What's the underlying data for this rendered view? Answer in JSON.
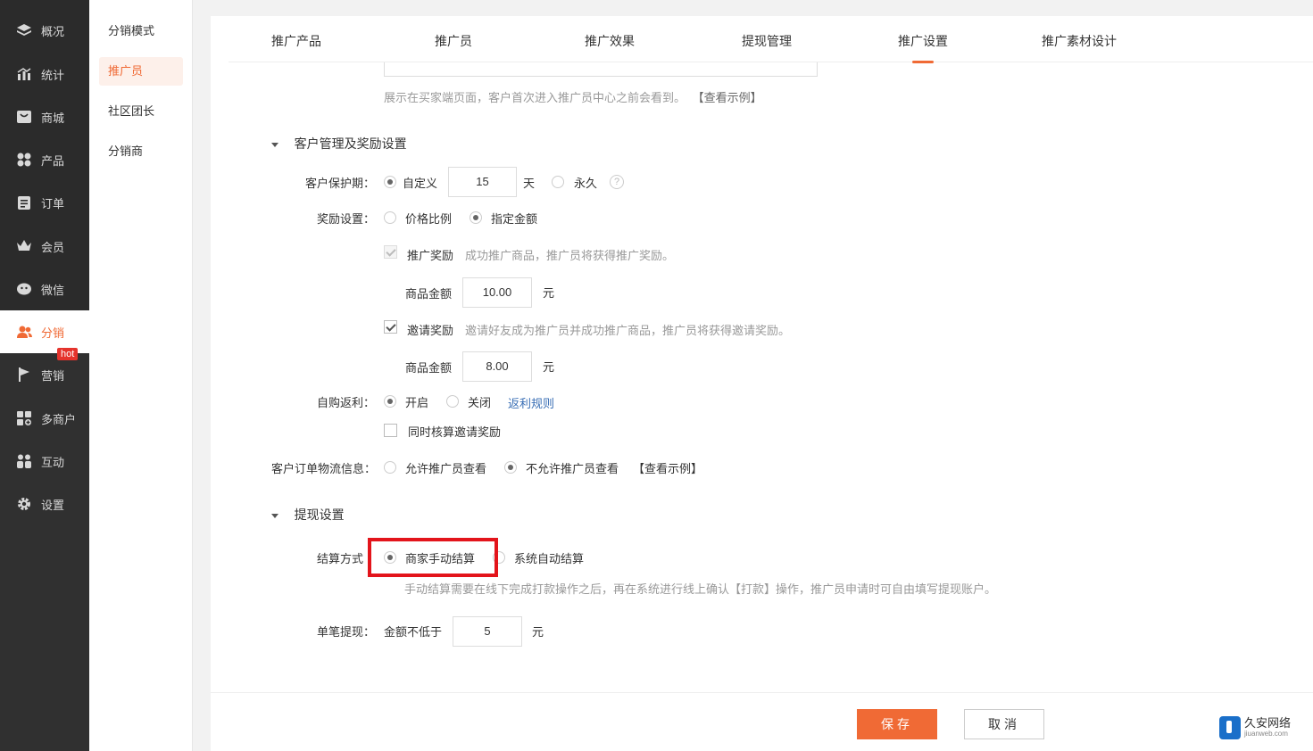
{
  "nav": {
    "items": [
      {
        "label": "概况",
        "icon": "layers-icon"
      },
      {
        "label": "统计",
        "icon": "chart-icon"
      },
      {
        "label": "商城",
        "icon": "store-icon"
      },
      {
        "label": "产品",
        "icon": "grid-icon"
      },
      {
        "label": "订单",
        "icon": "clipboard-icon"
      },
      {
        "label": "会员",
        "icon": "crown-icon"
      },
      {
        "label": "微信",
        "icon": "wechat-icon"
      },
      {
        "label": "分销",
        "icon": "users-icon"
      },
      {
        "label": "营销",
        "icon": "flag-icon"
      },
      {
        "label": "多商户",
        "icon": "shop-plus-icon"
      },
      {
        "label": "互动",
        "icon": "people-icon"
      },
      {
        "label": "设置",
        "icon": "gear-icon"
      }
    ],
    "hot_badge": "hot",
    "accent": "#f06a35"
  },
  "submenu": {
    "items": [
      "分销模式",
      "推广员",
      "社区团长",
      "分销商"
    ]
  },
  "tabs": [
    "推广产品",
    "推广员",
    "推广效果",
    "提现管理",
    "推广设置",
    "推广素材设计"
  ],
  "intro": {
    "hint": "展示在买家端页面，客户首次进入推广员中心之前会看到。",
    "example_link": "【查看示例】"
  },
  "customer_section": {
    "title": "客户管理及奖励设置",
    "protect_label": "客户保护期：",
    "protect_custom": "自定义",
    "protect_days": "15",
    "protect_unit": "天",
    "protect_forever": "永久",
    "help": "?",
    "reward_label": "奖励设置：",
    "reward_ratio": "价格比例",
    "reward_fixed": "指定金额",
    "promo_reward": "推广奖励",
    "promo_reward_desc": "成功推广商品，推广员将获得推广奖励。",
    "goods_amount_label": "商品金额",
    "promo_amount": "10.00",
    "yuan": "元",
    "invite_reward": "邀请奖励",
    "invite_reward_desc": "邀请好友成为推广员并成功推广商品，推广员将获得邀请奖励。",
    "invite_amount": "8.00",
    "rebate_label": "自购返利：",
    "rebate_on": "开启",
    "rebate_off": "关闭",
    "rebate_rule": "返利规则",
    "rebate_invite": "同时核算邀请奖励",
    "logistics_label": "客户订单物流信息：",
    "logistics_allow": "允许推广员查看",
    "logistics_deny": "不允许推广员查看",
    "logistics_example": "【查看示例】"
  },
  "withdraw_section": {
    "title": "提现设置",
    "settle_label": "结算方式",
    "settle_manual": "商家手动结算",
    "settle_auto": "系统自动结算",
    "settle_desc": "手动结算需要在线下完成打款操作之后，再在系统进行线上确认【打款】操作，推广员申请时可自由填写提现账户。",
    "single_label": "单笔提现：",
    "min_label": "金额不低于",
    "min_amount": "5",
    "yuan": "元"
  },
  "footer": {
    "save": "保存",
    "cancel": "取消"
  },
  "watermark": {
    "title": "久安网络",
    "domain": "jiuanweb.com"
  }
}
